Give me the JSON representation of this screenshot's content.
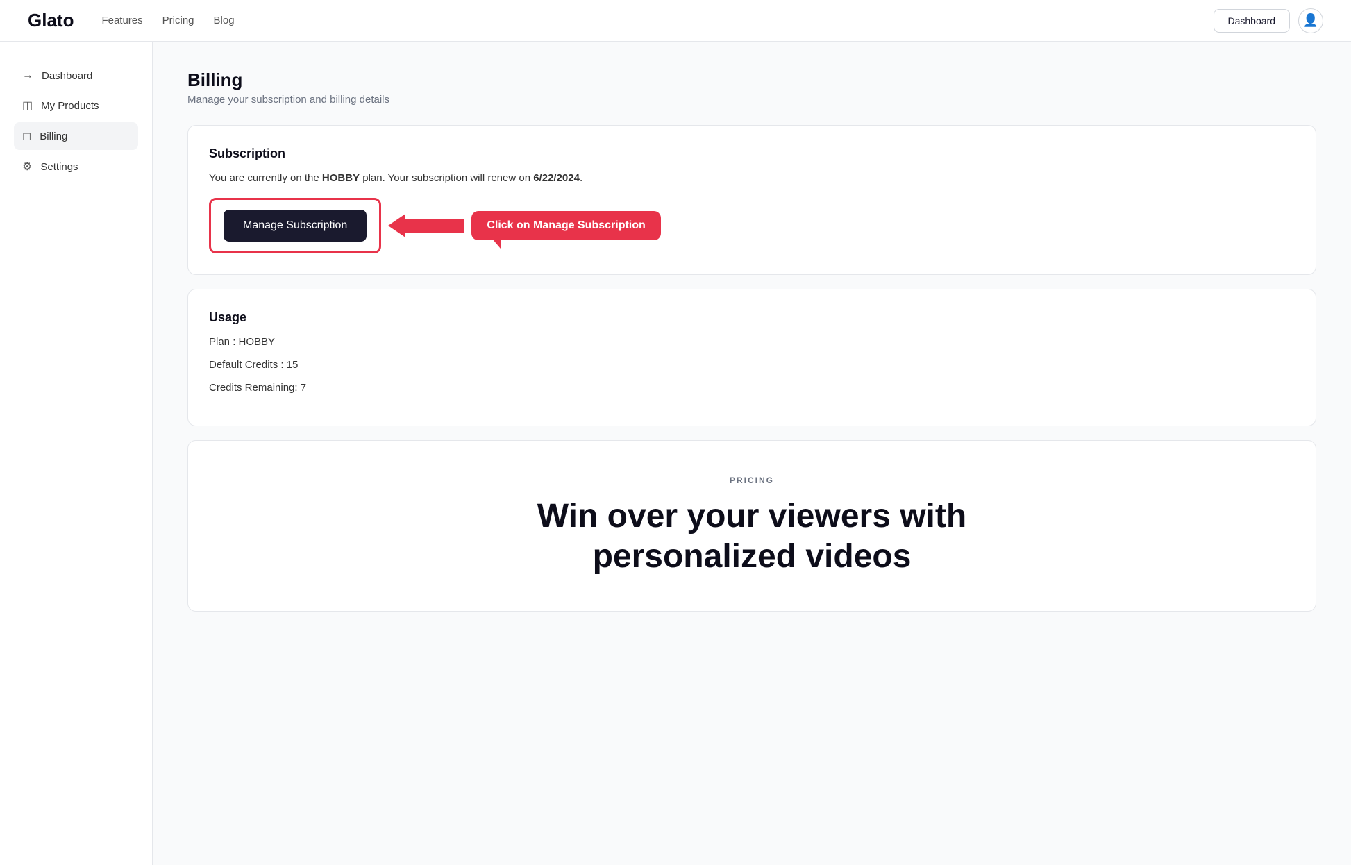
{
  "brand": {
    "logo": "Glato"
  },
  "nav": {
    "links": [
      "Features",
      "Pricing",
      "Blog"
    ],
    "dashboard_btn": "Dashboard"
  },
  "sidebar": {
    "items": [
      {
        "id": "dashboard",
        "label": "Dashboard",
        "icon": "→"
      },
      {
        "id": "my-products",
        "label": "My Products",
        "icon": "⊟"
      },
      {
        "id": "billing",
        "label": "Billing",
        "icon": "⊟",
        "active": true
      },
      {
        "id": "settings",
        "label": "Settings",
        "icon": "⚙"
      }
    ]
  },
  "page": {
    "title": "Billing",
    "subtitle": "Manage your subscription and billing details"
  },
  "subscription_card": {
    "title": "Subscription",
    "info_text": "You are currently on the ",
    "plan_name": "HOBBY",
    "info_text2": " plan. Your subscription will renew on ",
    "renew_date": "6/22/2024",
    "info_text3": ".",
    "manage_btn": "Manage Subscription",
    "callout": "Click on Manage Subscription"
  },
  "usage_card": {
    "title": "Usage",
    "plan_label": "Plan : HOBBY",
    "default_credits_label": "Default Credits : 15",
    "credits_remaining_label": "Credits Remaining: 7"
  },
  "pricing_section": {
    "label": "PRICING",
    "headline_line1": "Win over your viewers with",
    "headline_line2": "personalized videos"
  }
}
